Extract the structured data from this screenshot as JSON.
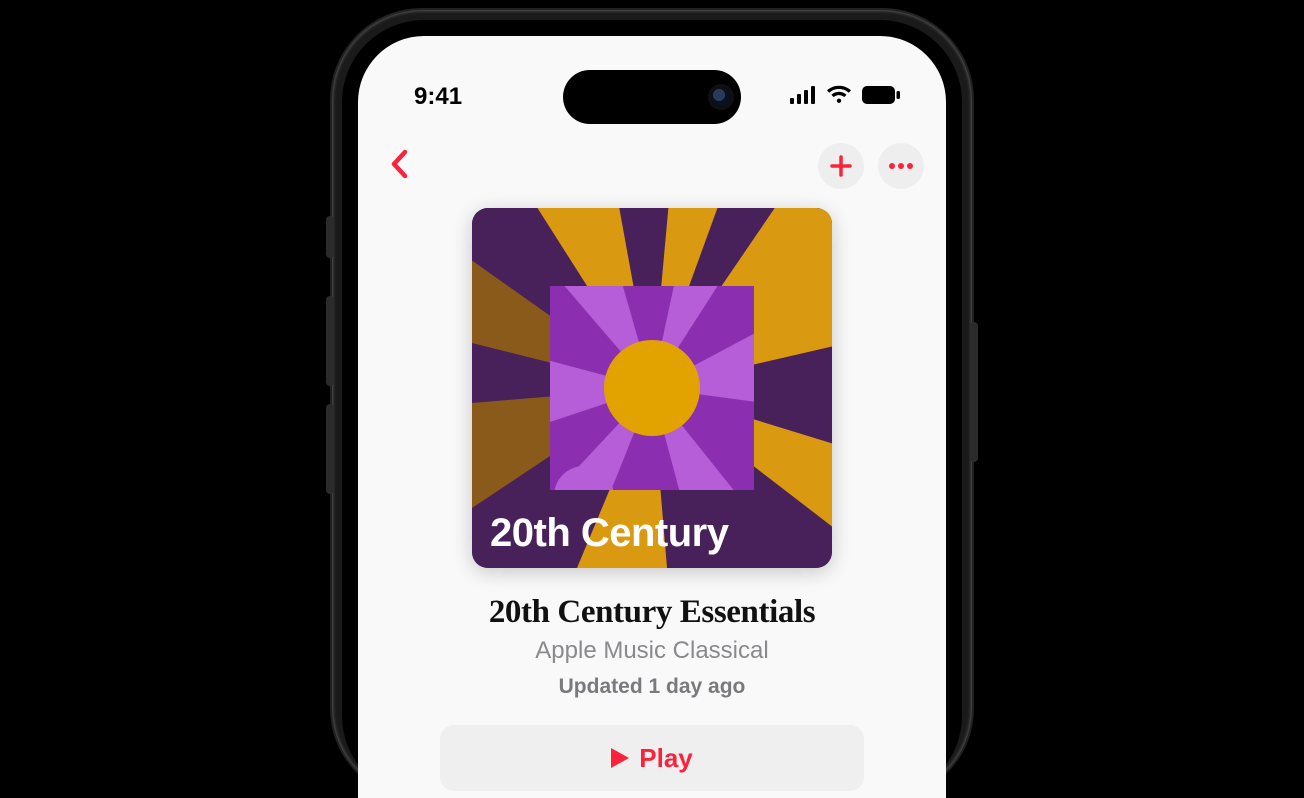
{
  "status": {
    "time": "9:41"
  },
  "nav": {
    "back": "Back",
    "add": "Add",
    "more": "More"
  },
  "artwork": {
    "label": "20th Century"
  },
  "playlist": {
    "title": "20th Century Essentials",
    "curator": "Apple Music Classical",
    "updated": "Updated 1 day ago"
  },
  "controls": {
    "play": "Play"
  },
  "colors": {
    "accent": "#fa233b"
  }
}
